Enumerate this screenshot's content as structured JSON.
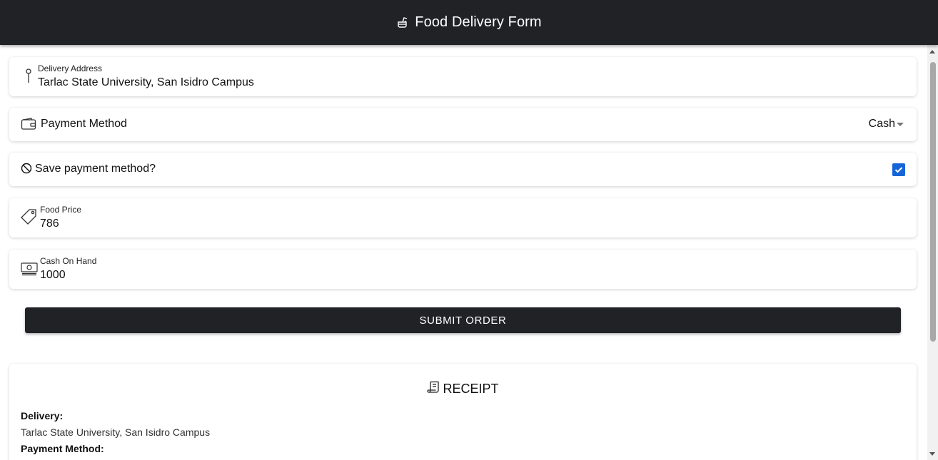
{
  "header": {
    "title": "Food Delivery Form",
    "icon": "fastfood-icon",
    "background": "#212226"
  },
  "delivery_address": {
    "label": "Delivery Address",
    "value": "Tarlac State University, San Isidro Campus",
    "icon": "pin-icon"
  },
  "payment_method": {
    "label": "Payment Method",
    "selected": "Cash",
    "icon": "wallet-icon"
  },
  "save_payment": {
    "label": "Save payment method?",
    "checked": true,
    "icon": "no-symbol-icon",
    "accent": "#1565d8"
  },
  "food_price": {
    "label": "Food Price",
    "value": "786",
    "icon": "price-tag-icon"
  },
  "cash_on_hand": {
    "label": "Cash On Hand",
    "value": "1000",
    "icon": "cash-icon"
  },
  "submit": {
    "label": "SUBMIT ORDER"
  },
  "receipt": {
    "title": "RECEIPT",
    "icon": "receipt-icon",
    "delivery_label": "Delivery:",
    "delivery_value": "Tarlac State University, San Isidro Campus",
    "payment_label": "Payment Method:"
  }
}
